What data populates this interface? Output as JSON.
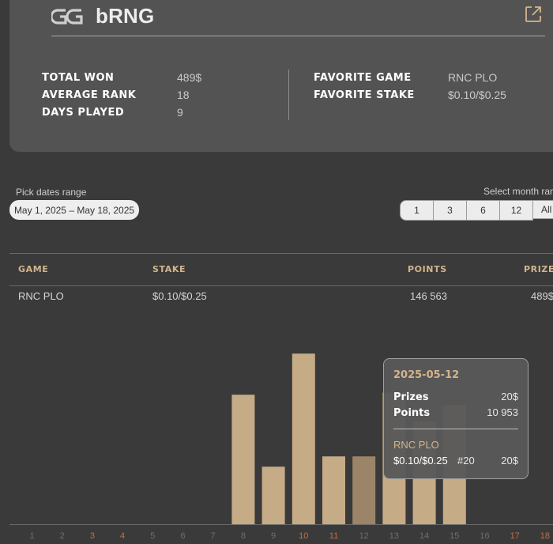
{
  "header": {
    "player_name": "bRNG",
    "logo_text": "GG",
    "external_link_icon": "external-link-icon"
  },
  "stats": {
    "left": [
      {
        "label": "TOTAL WON",
        "value": "489$"
      },
      {
        "label": "AVERAGE RANK",
        "value": "18"
      },
      {
        "label": "DAYS PLAYED",
        "value": "9"
      }
    ],
    "right": [
      {
        "label": "FAVORITE GAME",
        "value": "RNC PLO"
      },
      {
        "label": "FAVORITE STAKE",
        "value": "$0.10/$0.25"
      }
    ]
  },
  "filters": {
    "date_range_label": "Pick dates range",
    "date_range_value": "May 1, 2025 – May 18, 2025",
    "month_range_label": "Select month range",
    "month_buttons": [
      "1",
      "3",
      "6",
      "12",
      "All"
    ]
  },
  "table": {
    "headers": {
      "game": "GAME",
      "stake": "STAKE",
      "points": "POINTS",
      "prizes": "PRIZES"
    },
    "rows": [
      {
        "game": "RNC PLO",
        "stake": "$0.10/$0.25",
        "points": "146 563",
        "prizes": "489$"
      }
    ]
  },
  "chart_data": {
    "type": "bar",
    "categories": [
      "1",
      "2",
      "3",
      "4",
      "5",
      "6",
      "7",
      "8",
      "9",
      "10",
      "11",
      "12",
      "13",
      "14",
      "15",
      "16",
      "17",
      "18"
    ],
    "values": [
      0,
      0,
      0,
      0,
      0,
      0,
      0,
      63,
      28,
      83,
      33,
      33,
      64,
      50,
      58,
      0,
      0,
      0
    ],
    "highlighted_index": 11,
    "highlighted_category_colors": {
      "weekend": "#c0713f",
      "weekday": "#6f6f6f"
    },
    "weekend_categories": [
      "3",
      "4",
      "10",
      "11",
      "17",
      "18"
    ],
    "colors": {
      "bar": "#c6ab87",
      "bar_highlight": "#9c8469"
    }
  },
  "tooltip": {
    "date": "2025-05-12",
    "prizes_label": "Prizes",
    "prizes_value": "20$",
    "points_label": "Points",
    "points_value": "10 953",
    "game": "RNC PLO",
    "stake": "$0.10/$0.25",
    "rank": "#20",
    "prize": "20$"
  },
  "colors": {
    "accent": "#d3b48c",
    "card_bg": "#535353",
    "page_bg": "#3a3a3a"
  }
}
